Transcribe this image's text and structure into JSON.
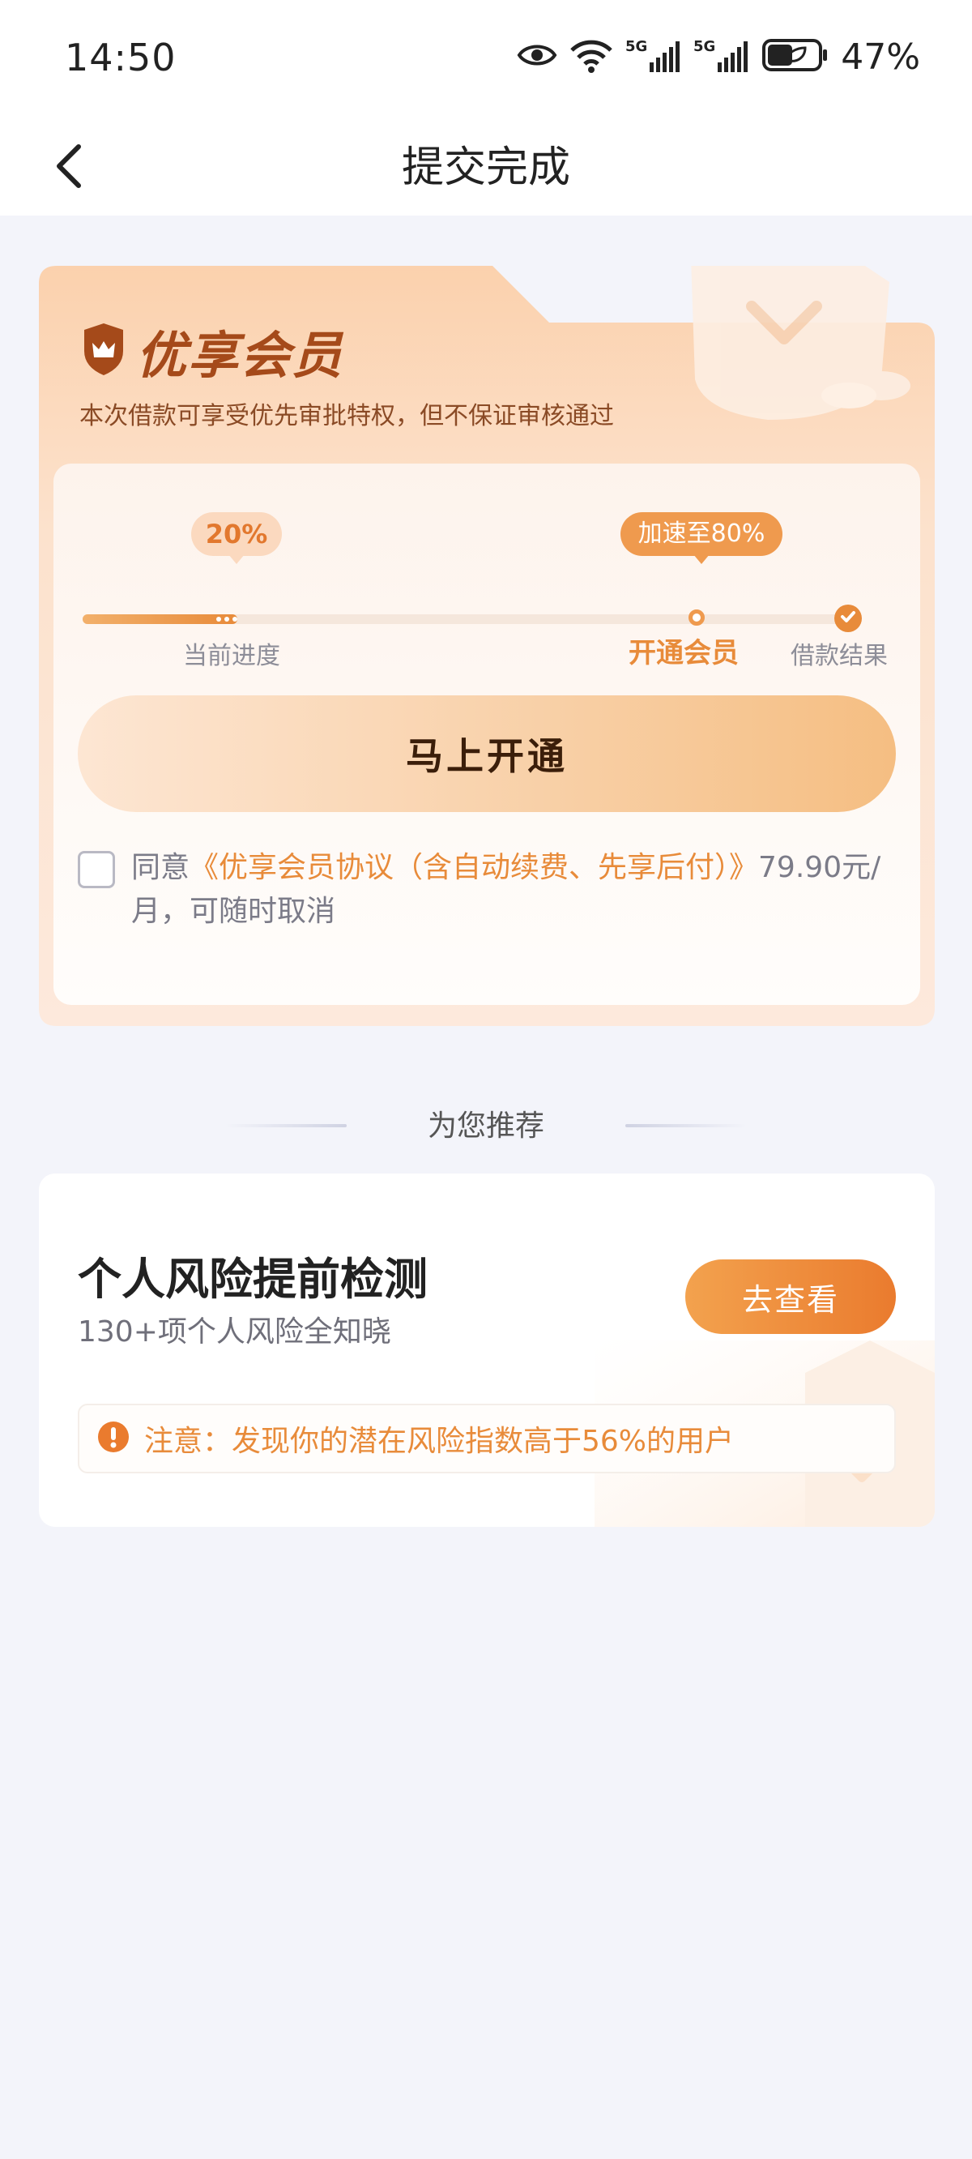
{
  "status_bar": {
    "time": "14:50",
    "battery": "47%",
    "network": "5G"
  },
  "nav": {
    "title": "提交完成"
  },
  "member": {
    "title": "优享会员",
    "subtitle": "本次借款可享受优先审批特权，但不保证审核通过",
    "progress_badge": "20%",
    "progress_value": 0.2,
    "speedup_badge": "加速至80%",
    "steps": {
      "current": "当前进度",
      "open": "开通会员",
      "result": "借款结果"
    },
    "open_button": "马上开通",
    "agreement": {
      "prefix": "同意",
      "link": "《优享会员协议（含自动续费、先享后付）》",
      "suffix": "79.90元/月，可随时取消"
    }
  },
  "recommend": {
    "heading": "为您推荐",
    "card": {
      "title": "个人风险提前检测",
      "desc": "130+项个人风险全知晓",
      "button": "去查看",
      "warning": "注意：发现你的潜在风险指数高于56%的用户"
    }
  },
  "colors": {
    "accent": "#e88b3a",
    "page_bg": "#f3f4fa",
    "brand_dark": "#a54a1a"
  }
}
